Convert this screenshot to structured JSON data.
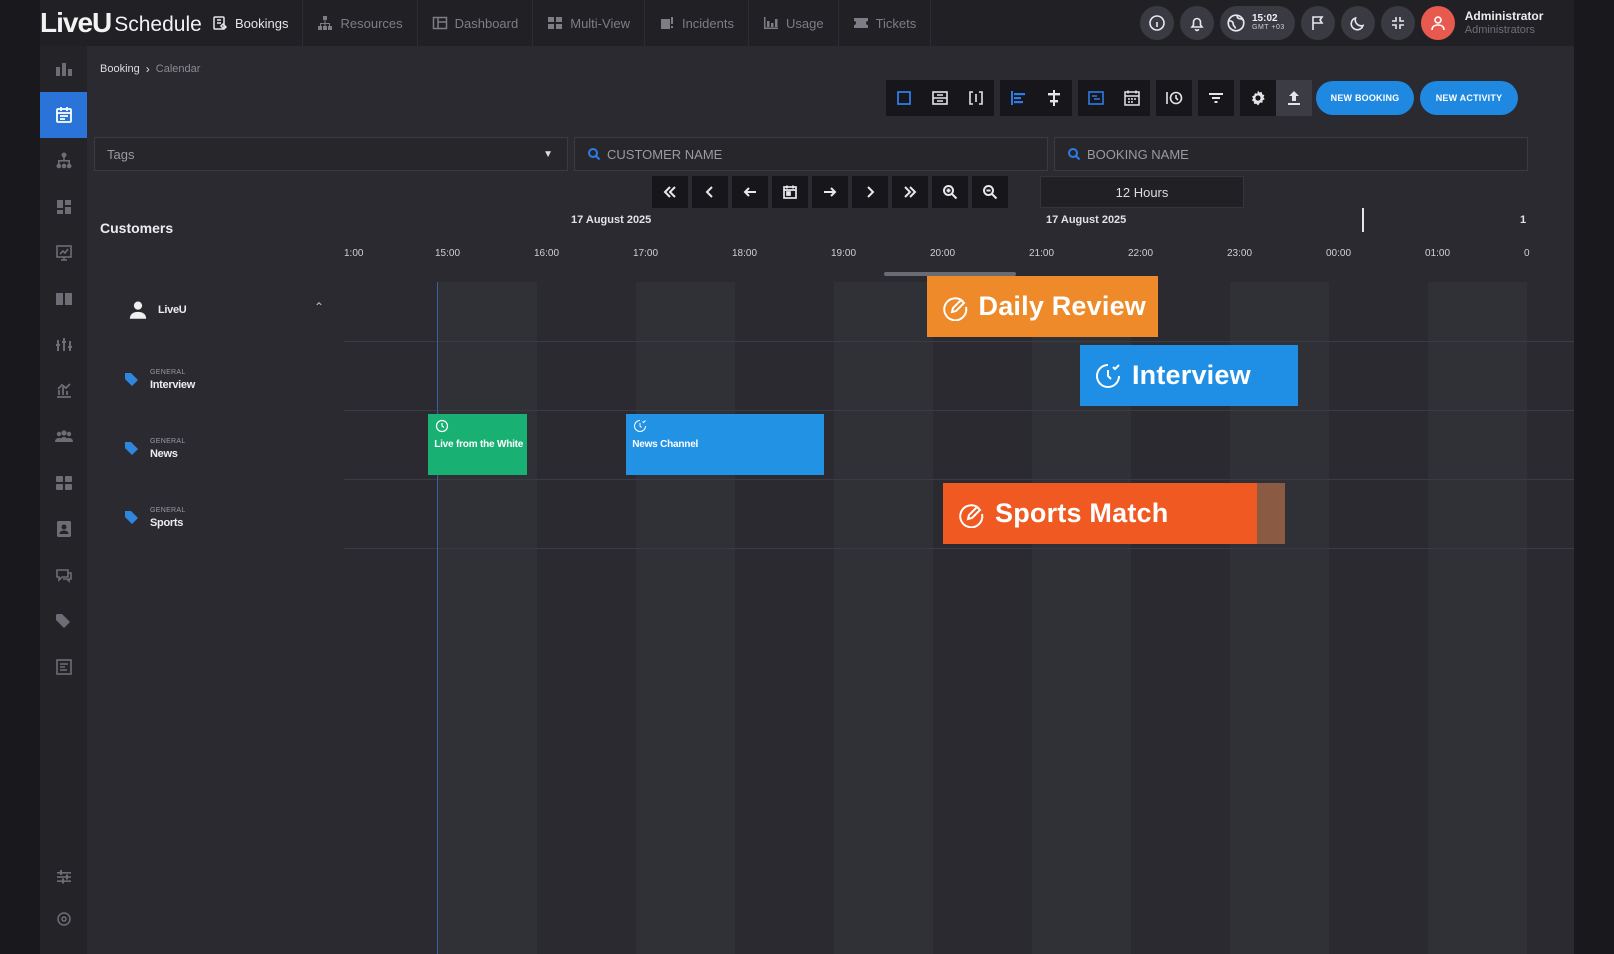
{
  "app": {
    "logo_live": "LiveU",
    "logo_schedule": "Schedule"
  },
  "nav": [
    {
      "label": "Bookings",
      "icon": "bookings-icon",
      "active": true
    },
    {
      "label": "Resources",
      "icon": "resources-icon"
    },
    {
      "label": "Dashboard",
      "icon": "dashboard-icon"
    },
    {
      "label": "Multi-View",
      "icon": "multi-view-icon"
    },
    {
      "label": "Incidents",
      "icon": "incidents-icon"
    },
    {
      "label": "Usage",
      "icon": "usage-icon"
    },
    {
      "label": "Tickets",
      "icon": "tickets-icon"
    }
  ],
  "header_right": {
    "clock_time": "15:02",
    "clock_zone": "GMT +03",
    "user_name": "Administrator",
    "user_role": "Administrators"
  },
  "breadcrumb": {
    "root": "Booking",
    "current": "Calendar"
  },
  "toolbar": {
    "new_booking": "NEW BOOKING",
    "new_activity": "NEW ACTIVITY"
  },
  "filters": {
    "tags": "Tags",
    "customer_name": "CUSTOMER NAME",
    "booking_name": "BOOKING NAME"
  },
  "timeline": {
    "zoom": "12 Hours",
    "customers_heading": "Customers",
    "date_labels": [
      "17 August 2025",
      "17 August 2025",
      "1"
    ],
    "hours": [
      "1:00",
      "15:00",
      "16:00",
      "17:00",
      "18:00",
      "19:00",
      "20:00",
      "21:00",
      "22:00",
      "23:00",
      "00:00",
      "01:00",
      "0"
    ]
  },
  "customers": [
    {
      "sub": "",
      "name": "LiveU",
      "icon": "user-icon"
    },
    {
      "sub": "GENERAL",
      "name": "Interview",
      "icon": "tag-icon"
    },
    {
      "sub": "GENERAL",
      "name": "News",
      "icon": "tag-icon"
    },
    {
      "sub": "GENERAL",
      "name": "Sports",
      "icon": "tag-icon"
    }
  ],
  "events": [
    {
      "label": "Daily Review",
      "color": "#ee8a2a",
      "icon": "edit-circle-icon",
      "row": 0,
      "start": "19:50",
      "end": "22:10"
    },
    {
      "label": "Interview",
      "color": "#1f8fe5",
      "icon": "clock-check-icon",
      "row": 1,
      "start": "21:23",
      "end": "23:35"
    },
    {
      "label": "Live from the White",
      "color": "#19b073",
      "icon": "clock-icon",
      "row": 2,
      "start": "14:48",
      "end": "15:48"
    },
    {
      "label": "News Channel",
      "color": "#2192e4",
      "icon": "clock-check-icon",
      "row": 2,
      "start": "16:48",
      "end": "18:48"
    },
    {
      "label": "Sports Match",
      "color": "#f05a22",
      "icon": "edit-circle-icon",
      "row": 3,
      "start": "20:00",
      "end": "23:10",
      "tail_color": "#8a5a42",
      "tail_end": "23:27"
    }
  ],
  "colors": {
    "accent": "#2e7bea",
    "sidebar_active": "#2a73d8",
    "button_blue": "#1f88e0",
    "avatar": "#e85a4f"
  }
}
